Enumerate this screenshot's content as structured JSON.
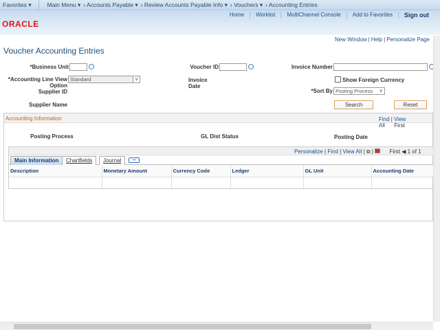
{
  "nav": {
    "favorites": "Favorites",
    "crumbs": [
      "Main Menu ▾",
      "› Accounts Payable ▾",
      "› Review Accounts Payable Info ▾",
      "› Vouchers ▾",
      "› Accounting Entries"
    ]
  },
  "header": {
    "logo": "ORACLE",
    "links": [
      "Home",
      "Worklist",
      "MultiChannel Console",
      "Add to Favorites"
    ],
    "signout": "Sign out"
  },
  "page_links": [
    "New Window",
    "Help",
    "Personalize Page"
  ],
  "title": "Voucher Accounting Entries",
  "form": {
    "business_unit": "*Business Unit",
    "voucher_id": "Voucher ID",
    "invoice_number": "Invoice Number",
    "line_view": "*Accounting Line View",
    "line_view_option": "Option",
    "line_view_value": "Standard",
    "invoice_date": "Invoice Date",
    "show_foreign": "Show Foreign Currency",
    "supplier_id": "Supplier ID",
    "sort_by": "*Sort By",
    "sort_by_value": "Posting Process",
    "supplier_name": "Supplier Name",
    "search": "Search",
    "reset": "Reset"
  },
  "accounting": {
    "title": "Accounting Information",
    "find": "Find",
    "view_all": "View All",
    "first": "First",
    "posting_process": "Posting Process",
    "gl_dist_status": "GL Dist Status",
    "posting_date": "Posting Date"
  },
  "grid": {
    "personalize": "Personalize",
    "find": "Find",
    "view_all": "View All",
    "first": "First",
    "range": "1 of 1",
    "tabs": [
      "Main Information",
      "Chartfields",
      "Journal"
    ],
    "columns": [
      "Description",
      "Monetary Amount",
      "Currency Code",
      "Ledger",
      "GL Unit",
      "Accounting Date"
    ]
  }
}
